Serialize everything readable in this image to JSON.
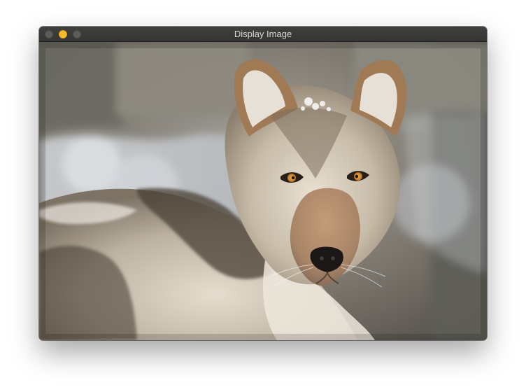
{
  "window": {
    "title": "Display Image",
    "traffic_lights": {
      "close_color": "#5d5d5b",
      "minimize_color": "#f6bb2a",
      "zoom_color": "#5d5d5b"
    }
  },
  "image": {
    "subject": "wolf-photo",
    "icon": "image-content"
  }
}
